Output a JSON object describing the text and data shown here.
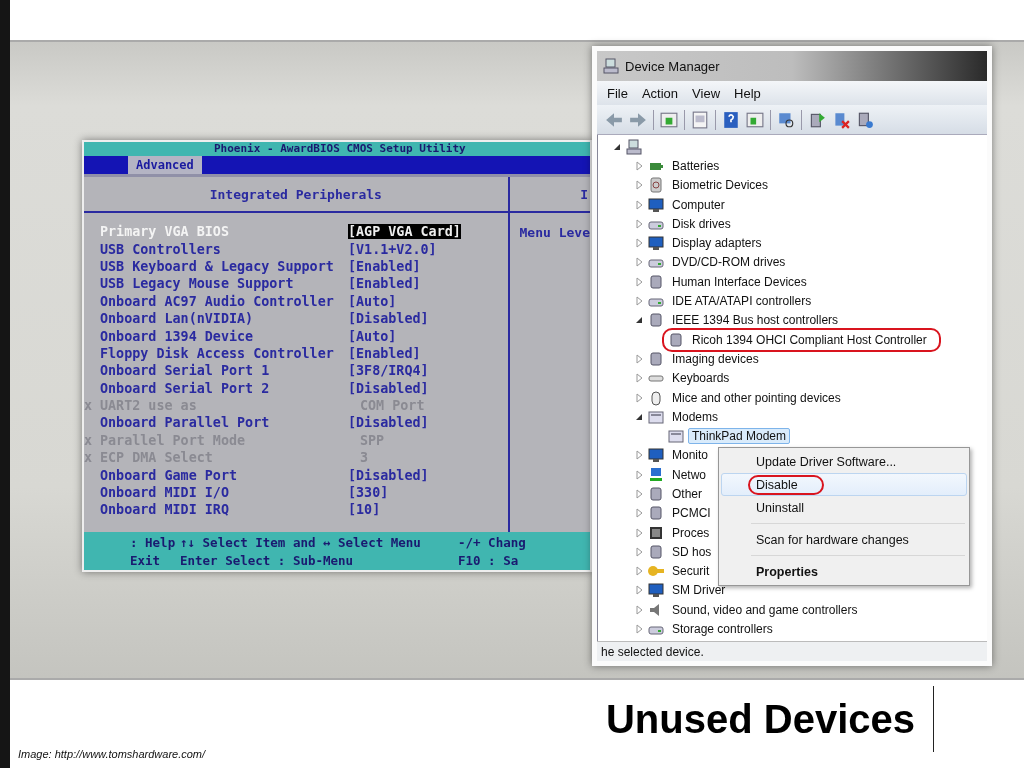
{
  "bios": {
    "title": "Phoenix - AwardBIOS CMOS Setup Utility",
    "tab": {
      "label": "Advanced",
      "selected": true
    },
    "section": "Integrated Peripherals",
    "help_header": "I",
    "help_text": "Menu Leve",
    "rows": [
      {
        "label": "Primary VGA BIOS",
        "value": "[AGP VGA Card]",
        "selected": true,
        "disabled": false
      },
      {
        "label": "USB Controllers",
        "value": "[V1.1+V2.0]",
        "selected": false,
        "disabled": false
      },
      {
        "label": "USB Keyboard & Legacy Support",
        "value": "[Enabled]",
        "selected": false,
        "disabled": false
      },
      {
        "label": "USB Legacy Mouse Support",
        "value": "[Enabled]",
        "selected": false,
        "disabled": false
      },
      {
        "label": "Onboard AC97 Audio Controller",
        "value": "[Auto]",
        "selected": false,
        "disabled": false
      },
      {
        "label": "Onboard Lan(nVIDIA)",
        "value": "[Disabled]",
        "selected": false,
        "disabled": false
      },
      {
        "label": "Onboard 1394 Device",
        "value": "[Auto]",
        "selected": false,
        "disabled": false
      },
      {
        "label": "Floppy Disk Access Controller",
        "value": "[Enabled]",
        "selected": false,
        "disabled": false
      },
      {
        "label": "Onboard Serial Port 1",
        "value": "[3F8/IRQ4]",
        "selected": false,
        "disabled": false
      },
      {
        "label": "Onboard Serial Port 2",
        "value": "[Disabled]",
        "selected": false,
        "disabled": false
      },
      {
        "prefix": "x",
        "label": "UART2 use as",
        "value": "COM Port",
        "selected": false,
        "disabled": true
      },
      {
        "label": "Onboard Parallel Port",
        "value": "[Disabled]",
        "selected": false,
        "disabled": false
      },
      {
        "prefix": "x",
        "label": "Parallel Port Mode",
        "value": "SPP",
        "selected": false,
        "disabled": true
      },
      {
        "prefix": "x",
        "label": "ECP DMA Select",
        "value": "3",
        "selected": false,
        "disabled": true
      },
      {
        "label": "Onboard Game Port",
        "value": "[Disabled]",
        "selected": false,
        "disabled": false
      },
      {
        "label": "Onboard MIDI I/O",
        "value": "[330]",
        "selected": false,
        "disabled": false
      },
      {
        "label": "Onboard MIDI IRQ",
        "value": "[10]",
        "selected": false,
        "disabled": false
      }
    ],
    "footer": [
      [
        ": Help",
        "↑↓ Select Item and ↔ Select Menu",
        "-/+ Chang"
      ],
      [
        "Exit",
        "Enter Select : Sub-Menu",
        "F10 : Sa"
      ]
    ]
  },
  "device_manager": {
    "title": "Device Manager",
    "menu": [
      "File",
      "Action",
      "View",
      "Help"
    ],
    "tree": {
      "kind": "computer",
      "expanded": true,
      "children": [
        {
          "label": "Batteries",
          "kind": "battery",
          "expanded": false
        },
        {
          "label": "Biometric Devices",
          "kind": "biometric",
          "expanded": false
        },
        {
          "label": "Computer",
          "kind": "monitor",
          "expanded": false
        },
        {
          "label": "Disk drives",
          "kind": "disk",
          "expanded": false
        },
        {
          "label": "Display adapters",
          "kind": "monitor",
          "expanded": false
        },
        {
          "label": "DVD/CD-ROM drives",
          "kind": "disk",
          "expanded": false
        },
        {
          "label": "Human Interface Devices",
          "kind": "device",
          "expanded": false
        },
        {
          "label": "IDE ATA/ATAPI controllers",
          "kind": "disk",
          "expanded": false
        },
        {
          "label": "IEEE 1394 Bus host controllers",
          "kind": "device",
          "expanded": true,
          "children": [
            {
              "label": "Ricoh 1394 OHCI Compliant Host Controller",
              "kind": "device",
              "selected": false,
              "highlighted": true
            }
          ]
        },
        {
          "label": "Imaging devices",
          "kind": "device",
          "expanded": false
        },
        {
          "label": "Keyboards",
          "kind": "keyboard",
          "expanded": false
        },
        {
          "label": "Mice and other pointing devices",
          "kind": "mouse",
          "expanded": false
        },
        {
          "label": "Modems",
          "kind": "modem",
          "expanded": true,
          "children": [
            {
              "label": "ThinkPad Modem",
              "kind": "modem",
              "selected": true,
              "highlighted": false
            }
          ]
        },
        {
          "label": "Monito",
          "kind": "monitor",
          "expanded": false
        },
        {
          "label": "Netwo",
          "kind": "network",
          "expanded": false
        },
        {
          "label": "Other",
          "kind": "device",
          "expanded": false
        },
        {
          "label": "PCMCI",
          "kind": "device",
          "expanded": false
        },
        {
          "label": "Proces",
          "kind": "chip",
          "expanded": false
        },
        {
          "label": "SD hos",
          "kind": "device",
          "expanded": false
        },
        {
          "label": "Securit",
          "kind": "key",
          "expanded": false
        },
        {
          "label": "SM Driver",
          "kind": "monitor",
          "expanded": false
        },
        {
          "label": "Sound, video and game controllers",
          "kind": "sound",
          "expanded": false
        },
        {
          "label": "Storage controllers",
          "kind": "disk",
          "expanded": false
        }
      ]
    },
    "context_menu": [
      {
        "kind": "item",
        "label": "Update Driver Software...",
        "selected": false,
        "highlighted": false,
        "default": false
      },
      {
        "kind": "item",
        "label": "Disable",
        "selected": true,
        "highlighted": true,
        "default": false
      },
      {
        "kind": "item",
        "label": "Uninstall",
        "selected": false,
        "highlighted": false,
        "default": false
      },
      {
        "kind": "separator"
      },
      {
        "kind": "item",
        "label": "Scan for hardware changes",
        "selected": false,
        "highlighted": false,
        "default": false
      },
      {
        "kind": "separator"
      },
      {
        "kind": "item",
        "label": "Properties",
        "selected": false,
        "highlighted": false,
        "default": true
      }
    ],
    "status_bar": "he selected device."
  },
  "slide": {
    "title": "Unused Devices",
    "caption": "Image: http://www.tomshardware.com/"
  }
}
